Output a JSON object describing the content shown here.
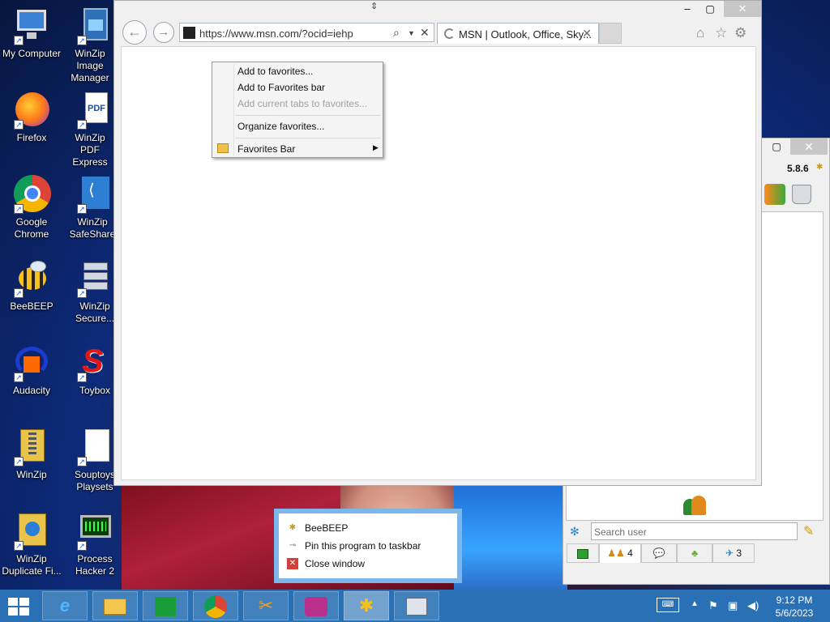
{
  "desktop_icons": [
    {
      "label": "My Computer",
      "icon": "computer-icon"
    },
    {
      "label": "WinZip Image Manager",
      "icon": "winzip-image-icon"
    },
    {
      "label": "Firefox",
      "icon": "firefox-icon"
    },
    {
      "label": "WinZip PDF Express",
      "icon": "pdf-icon"
    },
    {
      "label": "Google Chrome",
      "icon": "chrome-icon"
    },
    {
      "label": "WinZip SafeShare",
      "icon": "share-icon"
    },
    {
      "label": "BeeBEEP",
      "icon": "bee-icon"
    },
    {
      "label": "WinZip Secure...",
      "icon": "server-icon"
    },
    {
      "label": "Audacity",
      "icon": "audacity-icon"
    },
    {
      "label": "Toybox",
      "icon": "toybox-icon"
    },
    {
      "label": "WinZip",
      "icon": "winzip-icon"
    },
    {
      "label": "Souptoys Playsets",
      "icon": "document-icon"
    },
    {
      "label": "WinZip Duplicate Fi...",
      "icon": "winzip-duplicate-icon"
    },
    {
      "label": "Process Hacker 2",
      "icon": "process-hacker-icon"
    }
  ],
  "browser": {
    "url": "https://www.msn.com/?ocid=iehp",
    "tab_title": "MSN | Outlook, Office, Sky...",
    "favorites_menu": {
      "items": [
        {
          "label": "Add to favorites...",
          "enabled": true
        },
        {
          "label": "Add to Favorites bar",
          "enabled": true
        },
        {
          "label": "Add current tabs to favorites...",
          "enabled": false
        },
        {
          "label": "Organize favorites...",
          "enabled": true
        },
        {
          "label": "Favorites Bar",
          "enabled": true,
          "submenu": true
        }
      ]
    }
  },
  "beebeep": {
    "version": "5.8.6",
    "search_placeholder": "Search user",
    "tabs": [
      {
        "icon": "monitor-icon",
        "count": ""
      },
      {
        "icon": "users-icon",
        "count": "4"
      },
      {
        "icon": "chat-icon",
        "count": ""
      },
      {
        "icon": "group-icon",
        "count": ""
      },
      {
        "icon": "share-file-icon",
        "count": "3"
      }
    ]
  },
  "jump_list": {
    "items": [
      {
        "label": "BeeBEEP",
        "icon": "bee-icon"
      },
      {
        "label": "Pin this program to taskbar",
        "icon": "pin-icon"
      },
      {
        "label": "Close window",
        "icon": "close-icon"
      }
    ]
  },
  "taskbar": {
    "apps": [
      "internet-explorer-icon",
      "file-explorer-icon",
      "store-icon",
      "chrome-icon",
      "tools-icon",
      "camera-icon",
      "bee-icon",
      "window-icon"
    ],
    "time": "9:12 PM",
    "date": "5/6/2023"
  }
}
